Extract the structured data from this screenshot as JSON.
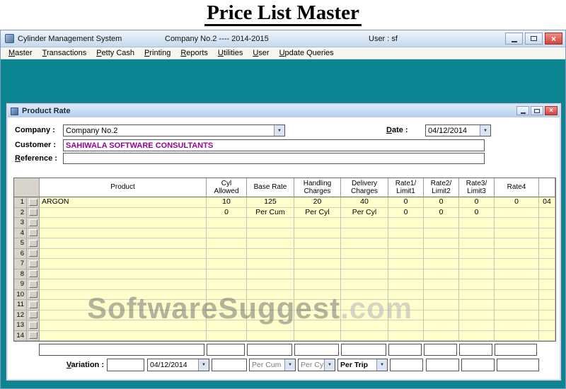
{
  "page": {
    "title": "Price List Master"
  },
  "window": {
    "title": "Cylinder Management System",
    "center_title": "Company No.2 ---- 2014-2015",
    "user": "User : sf"
  },
  "menu": {
    "items": [
      "Master",
      "Transactions",
      "Petty Cash",
      "Printing",
      "Reports",
      "Utilities",
      "User",
      "Update Queries"
    ]
  },
  "dialog": {
    "title": "Product Rate",
    "form": {
      "company_label": "Company :",
      "company_value": "Company No.2",
      "date_label": "Date :",
      "date_value": "04/12/2014",
      "customer_label": "Customer :",
      "customer_value": "SAHIWALA SOFTWARE CONSULTANTS",
      "reference_label": "Reference :",
      "reference_value": ""
    },
    "grid": {
      "headers": [
        "Product",
        "Cyl\nAllowed",
        "Base Rate",
        "Handling\nCharges",
        "Delivery\nCharges",
        "Rate1/\nLimit1",
        "Rate2/\nLimit2",
        "Rate3/\nLimit3",
        "Rate4",
        ""
      ],
      "row_count": 14,
      "rows": [
        {
          "product": "ARGON",
          "values": [
            "10",
            "125",
            "20",
            "40",
            "0",
            "0",
            "0",
            "0",
            "04"
          ]
        },
        {
          "product": "",
          "values": [
            "0",
            "Per Cum",
            "Per Cyl",
            "Per Cyl",
            "0",
            "0",
            "0",
            "",
            ""
          ]
        }
      ]
    },
    "footer": {
      "variation_label": "Variation :",
      "variation_value": "",
      "date_value": "04/12/2014",
      "unit1": "Per Cum",
      "unit2": "Per Cyl",
      "unit3": "Per Trip"
    }
  },
  "watermark": {
    "text": "SoftwareSuggest",
    "suffix": ".com"
  },
  "colors": {
    "teal_background": "#0C8593",
    "grid_row": "#FFFFCC",
    "customer_text": "#990099",
    "close_button": "#D2423A"
  }
}
